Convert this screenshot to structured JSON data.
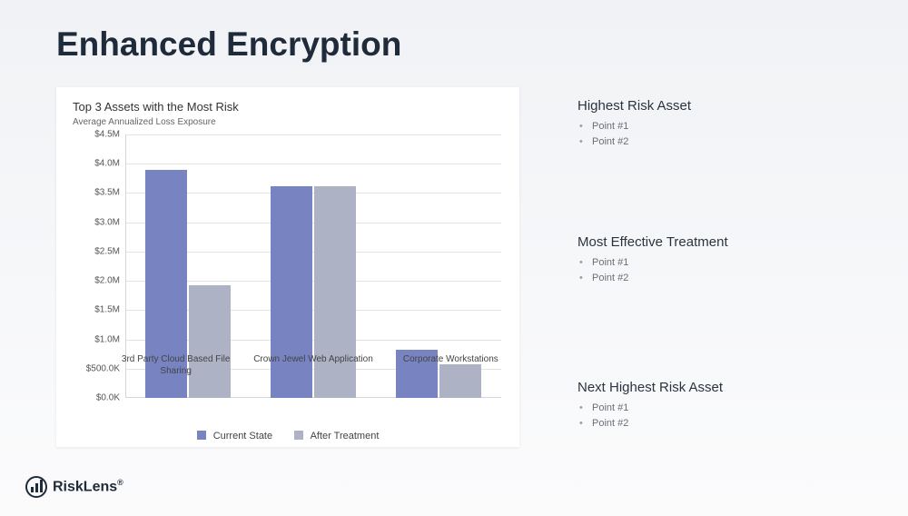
{
  "title": "Enhanced Encryption",
  "chart_card": {
    "title": "Top 3 Assets with the Most Risk",
    "subtitle": "Average Annualized Loss Exposure"
  },
  "chart_data": {
    "type": "bar",
    "categories": [
      "3rd Party Cloud Based File Sharing",
      "Crown Jewel Web Application",
      "Corporate Workstations"
    ],
    "series": [
      {
        "name": "Current State",
        "values": [
          3900000,
          3620000,
          820000
        ],
        "color": "#7884c2"
      },
      {
        "name": "After Treatment",
        "values": [
          1920000,
          3620000,
          580000
        ],
        "color": "#adb2c5"
      }
    ],
    "ylabel": "",
    "ylim": [
      0,
      4500000
    ],
    "y_ticks": [
      {
        "v": 0,
        "label": "$0.0K"
      },
      {
        "v": 500000,
        "label": "$500.0K"
      },
      {
        "v": 1000000,
        "label": "$1.0M"
      },
      {
        "v": 1500000,
        "label": "$1.5M"
      },
      {
        "v": 2000000,
        "label": "$2.0M"
      },
      {
        "v": 2500000,
        "label": "$2.5M"
      },
      {
        "v": 3000000,
        "label": "$3.0M"
      },
      {
        "v": 3500000,
        "label": "$3.5M"
      },
      {
        "v": 4000000,
        "label": "$4.0M"
      },
      {
        "v": 4500000,
        "label": "$4.5M"
      }
    ]
  },
  "sections": [
    {
      "heading": "Highest Risk Asset",
      "points": [
        "Point #1",
        "Point #2"
      ]
    },
    {
      "heading": "Most Effective Treatment",
      "points": [
        "Point #1",
        "Point #2"
      ]
    },
    {
      "heading": "Next Highest Risk Asset",
      "points": [
        "Point #1",
        "Point #2"
      ]
    }
  ],
  "brand": "RiskLens"
}
